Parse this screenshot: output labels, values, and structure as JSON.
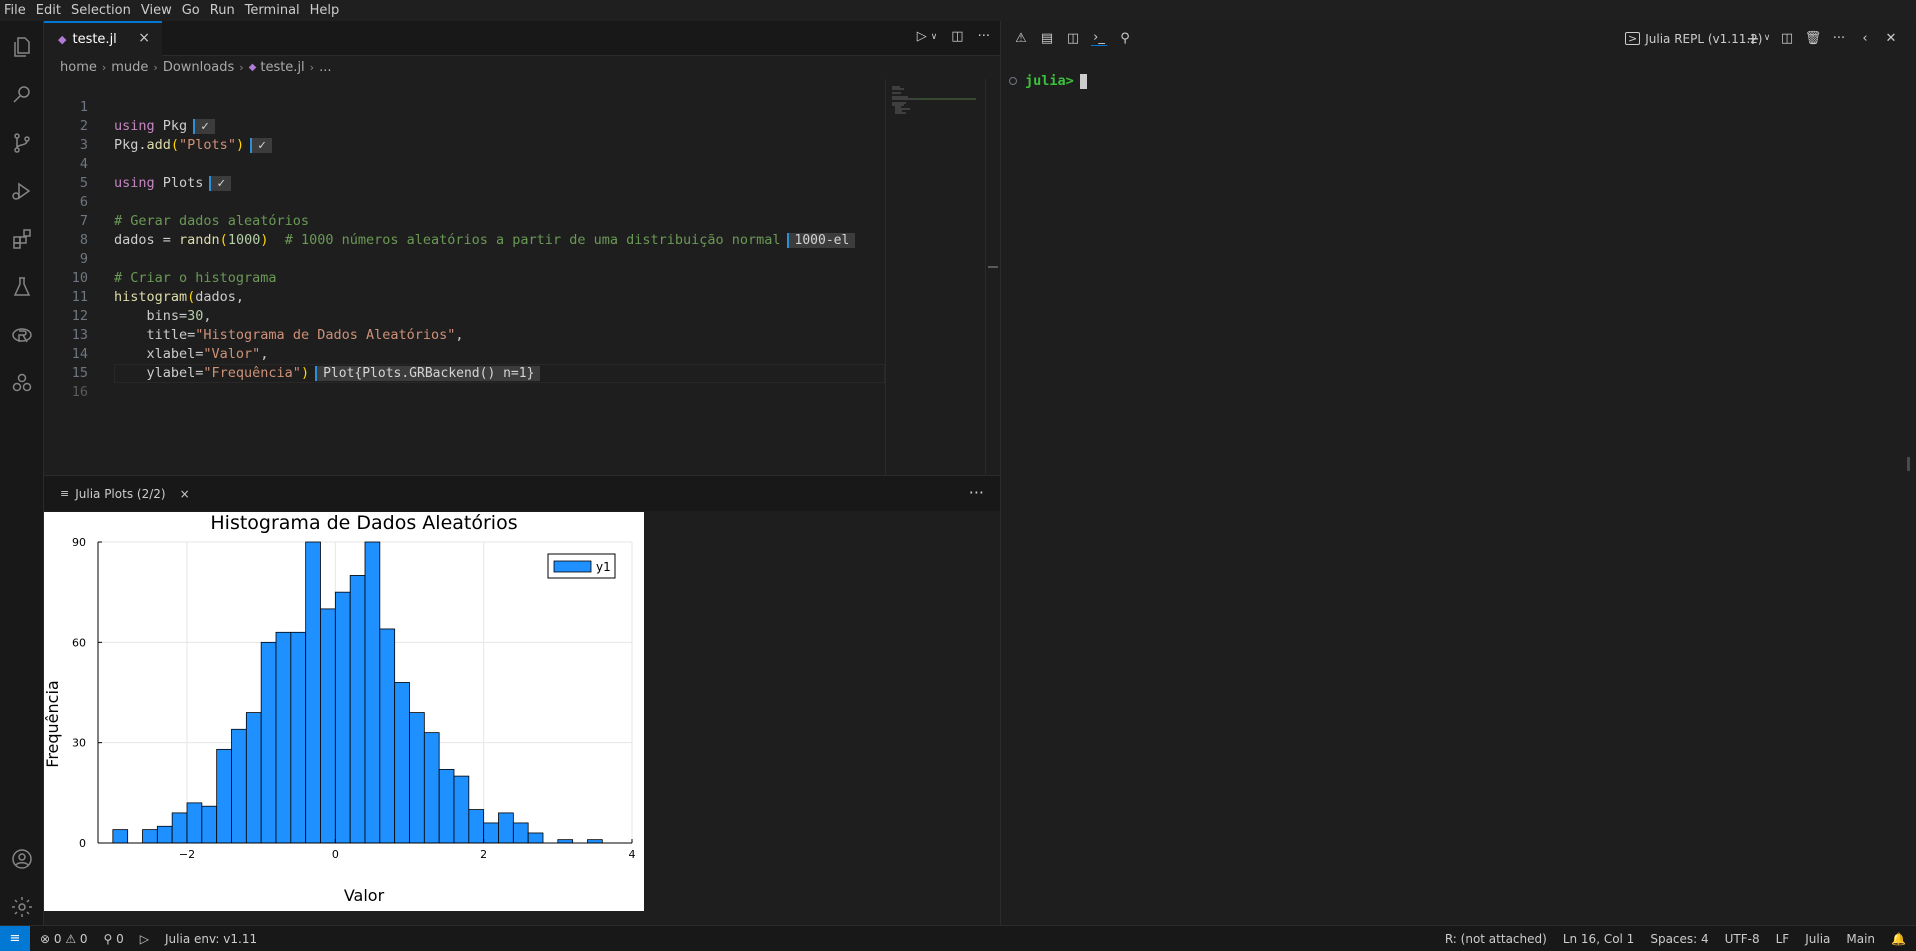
{
  "menu": [
    "File",
    "Edit",
    "Selection",
    "View",
    "Go",
    "Run",
    "Terminal",
    "Help"
  ],
  "editor": {
    "tab_label": "teste.jl",
    "tab_close": "×",
    "breadcrumbs": [
      "home",
      "mude",
      "Downloads",
      "teste.jl",
      "..."
    ],
    "line_numbers": [
      "1",
      "2",
      "3",
      "4",
      "5",
      "6",
      "7",
      "8",
      "9",
      "10",
      "11",
      "12",
      "13",
      "14",
      "15",
      "16"
    ],
    "lines": {
      "l1": {
        "kw": "using",
        "rest": " Pkg",
        "result": "✓"
      },
      "l2": {
        "pre": "Pkg.",
        "fn": "add",
        "p1": "(",
        "str": "\"Plots\"",
        "p2": ")",
        "result": "✓"
      },
      "l4": {
        "kw": "using",
        "rest": " Plots",
        "result": "✓"
      },
      "l6": {
        "cmt": "# Gerar dados aleatórios"
      },
      "l7": {
        "pre": "dados = ",
        "fn": "randn",
        "p1": "(",
        "num": "1000",
        "p2": ")",
        "cmt": "  # 1000 números aleatórios a partir de uma distribuição normal",
        "result": "1000-el"
      },
      "l9": {
        "cmt": "# Criar o histograma"
      },
      "l10": {
        "fn": "histogram",
        "p1": "(",
        "rest": "dados,"
      },
      "l11": {
        "pre": "    bins=",
        "num": "30",
        "rest": ","
      },
      "l12": {
        "pre": "    title=",
        "str": "\"Histograma de Dados Aleatórios\"",
        "rest": ","
      },
      "l13": {
        "pre": "    xlabel=",
        "str": "\"Valor\"",
        "rest": ","
      },
      "l14": {
        "pre": "    ylabel=",
        "str": "\"Frequência\"",
        "p2": ")",
        "result": "Plot{Plots.GRBackend() n=1}"
      }
    }
  },
  "plot_pane": {
    "tab_label": "Julia Plots (2/2)",
    "tab_close": "×",
    "more": "···"
  },
  "terminal": {
    "title": "Julia REPL (v1.11.2)",
    "prompt": "julia>"
  },
  "status": {
    "problems": "⊗ 0 ⚠ 0",
    "ports": "⚲ 0",
    "julia_env": "Julia env: v1.11",
    "r_status": "R: (not attached)",
    "cursor_pos": "Ln 16, Col 1",
    "spaces": "Spaces: 4",
    "encoding": "UTF-8",
    "eol": "LF",
    "language": "Julia",
    "branch": "Main"
  },
  "chart_data": {
    "type": "bar",
    "title": "Histograma de Dados Aleatórios",
    "xlabel": "Valor",
    "ylabel": "Frequência",
    "legend": [
      "y1"
    ],
    "legend_position": "top-right",
    "xlim": [
      -3.2,
      4
    ],
    "ylim": [
      0,
      90
    ],
    "xticks": [
      "−2",
      "0",
      "2",
      "4"
    ],
    "yticks": [
      "0",
      "30",
      "60",
      "90"
    ],
    "grid": true,
    "bar_color": "#1e90ff",
    "bin_width": 0.2,
    "bin_starts": [
      -3.0,
      -2.8,
      -2.6,
      -2.4,
      -2.2,
      -2.0,
      -1.8,
      -1.6,
      -1.4,
      -1.2,
      -1.0,
      -0.8,
      -0.6,
      -0.4,
      -0.2,
      0.0,
      0.2,
      0.4,
      0.6,
      0.8,
      1.0,
      1.2,
      1.4,
      1.6,
      1.8,
      2.0,
      2.2,
      2.4,
      2.6,
      2.8,
      3.0,
      3.2,
      3.4
    ],
    "values": [
      4,
      0,
      4,
      5,
      9,
      12,
      11,
      28,
      34,
      39,
      60,
      63,
      63,
      90,
      70,
      75,
      80,
      90,
      64,
      48,
      39,
      33,
      22,
      20,
      10,
      6,
      9,
      6,
      3,
      0,
      1,
      0,
      1
    ]
  }
}
